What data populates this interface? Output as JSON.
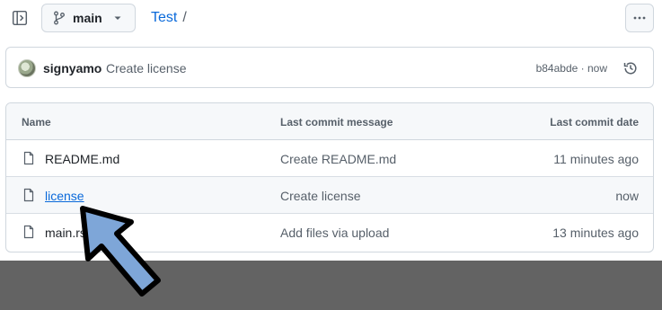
{
  "header": {
    "branch": "main",
    "repo": "Test",
    "separator": "/"
  },
  "commit": {
    "author": "signyamo",
    "message": "Create license",
    "sha": "b84abde",
    "dot": "·",
    "time": "now"
  },
  "table": {
    "headers": {
      "name": "Name",
      "message": "Last commit message",
      "date": "Last commit date"
    },
    "rows": [
      {
        "name": "README.md",
        "message": "Create README.md",
        "date": "11 minutes ago"
      },
      {
        "name": "license",
        "message": "Create license",
        "date": "now"
      },
      {
        "name": "main.rs",
        "message": "Add files via upload",
        "date": "13 minutes ago"
      }
    ]
  },
  "colors": {
    "link": "#0969da",
    "pointer_fill": "#7ea6d8",
    "overlay": "#636363"
  }
}
